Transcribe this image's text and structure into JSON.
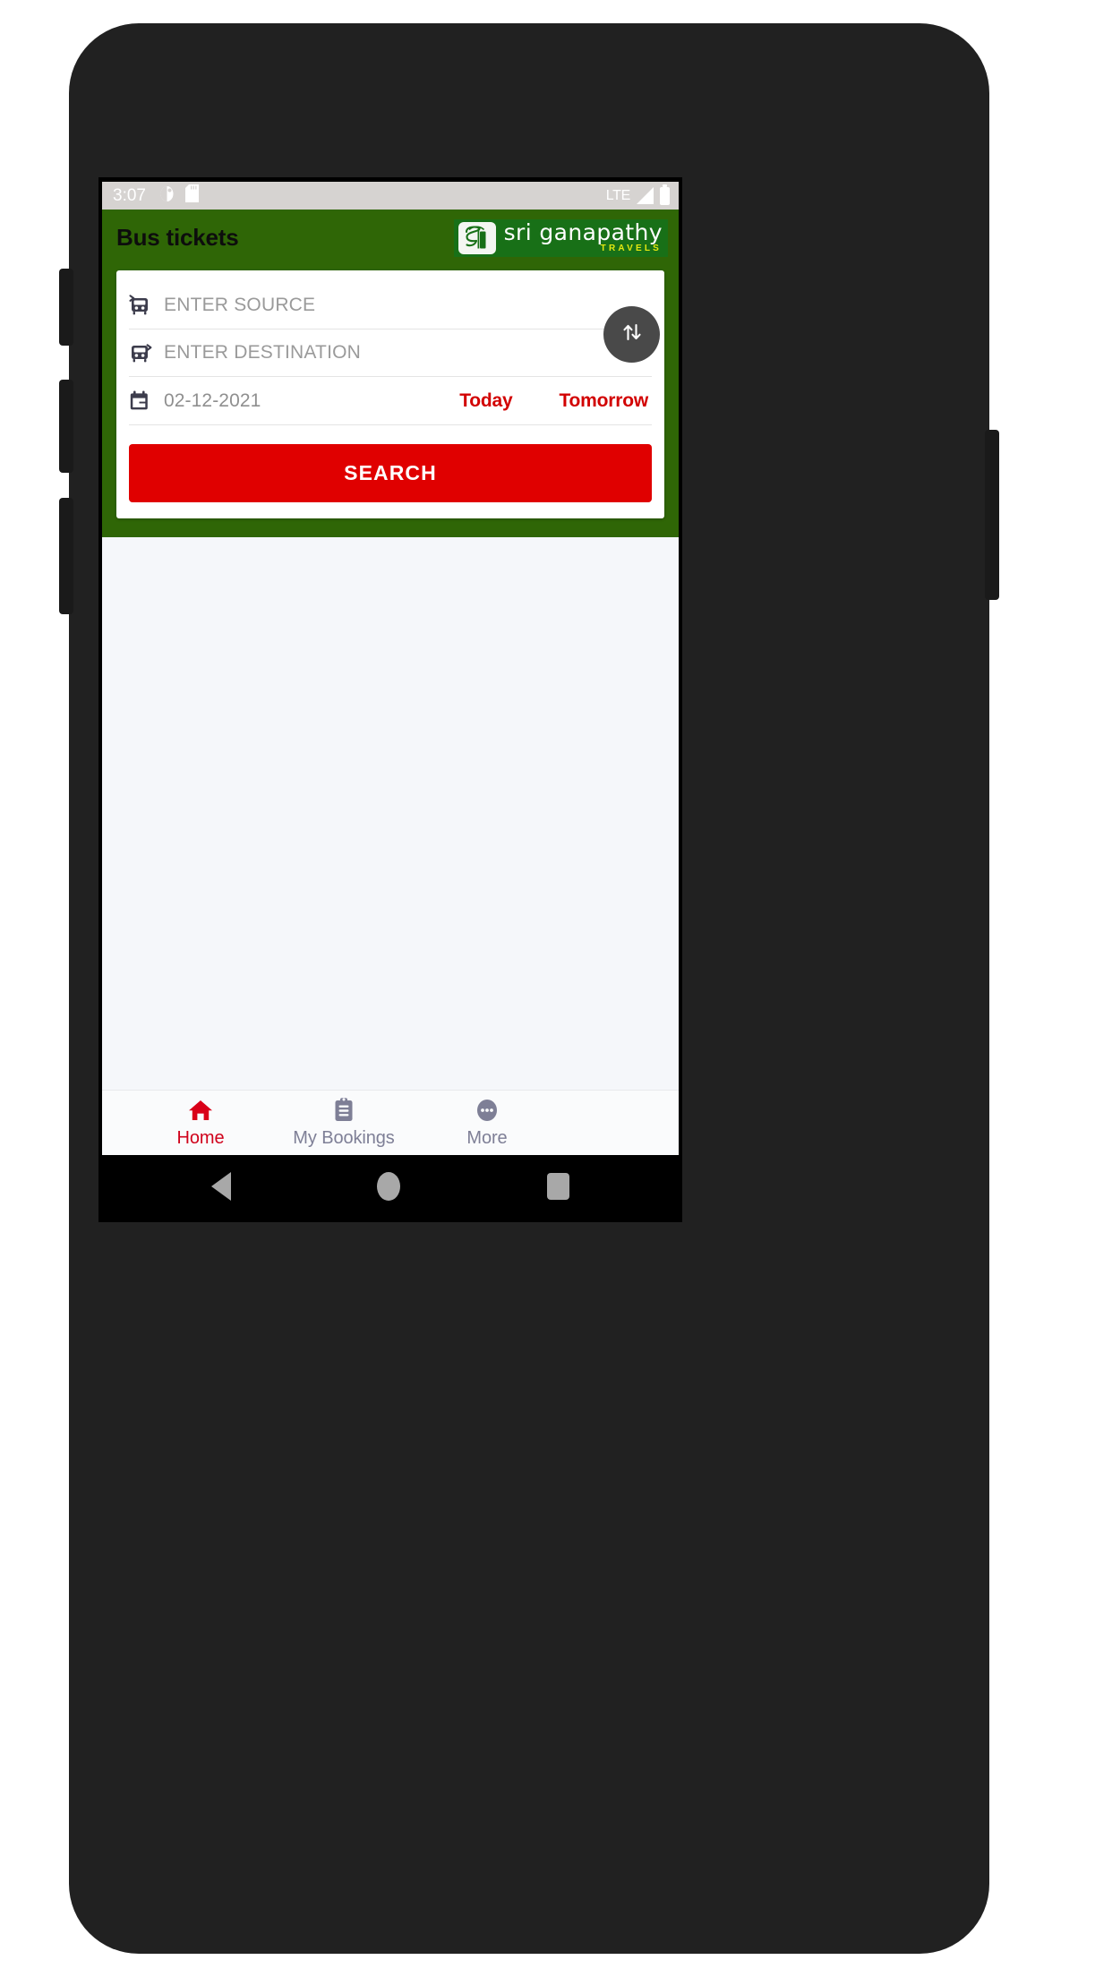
{
  "status_bar": {
    "time": "3:07",
    "icons_left": [
      "do-not-disturb-icon",
      "sd-card-icon"
    ],
    "network": "LTE",
    "icons_right": [
      "signal-icon",
      "battery-icon"
    ]
  },
  "app_bar": {
    "title": "Bus tickets",
    "logo": {
      "mark": "sg-monogram-icon",
      "name": "sri ganapathy",
      "tagline": "TRAVELS"
    }
  },
  "search_card": {
    "source": {
      "icon": "bus-arrive-icon",
      "value": "",
      "placeholder": "ENTER SOURCE"
    },
    "destination": {
      "icon": "bus-depart-icon",
      "value": "",
      "placeholder": "ENTER DESTINATION"
    },
    "date": {
      "icon": "calendar-icon",
      "value": "02-12-2021"
    },
    "quick_dates": [
      {
        "label": "Today"
      },
      {
        "label": "Tomorrow"
      }
    ],
    "swap": {
      "icon": "swap-vertical-icon"
    },
    "search_button": {
      "label": "SEARCH"
    }
  },
  "bottom_nav": {
    "items": [
      {
        "label": "Home",
        "icon": "home-icon",
        "active": true
      },
      {
        "label": "My Bookings",
        "icon": "clipboard-icon",
        "active": false
      },
      {
        "label": "More",
        "icon": "ellipsis-icon",
        "active": false
      }
    ]
  },
  "android_nav": {
    "back": "back-triangle-icon",
    "home": "home-circle-icon",
    "recents": "recents-square-icon"
  },
  "colors": {
    "brand_green": "#2f6606",
    "logo_green": "#187017",
    "accent_red": "#e00000",
    "quick_red": "#d20000",
    "nav_inactive": "#7e7f96",
    "tagline_yellow": "#e3e810"
  }
}
